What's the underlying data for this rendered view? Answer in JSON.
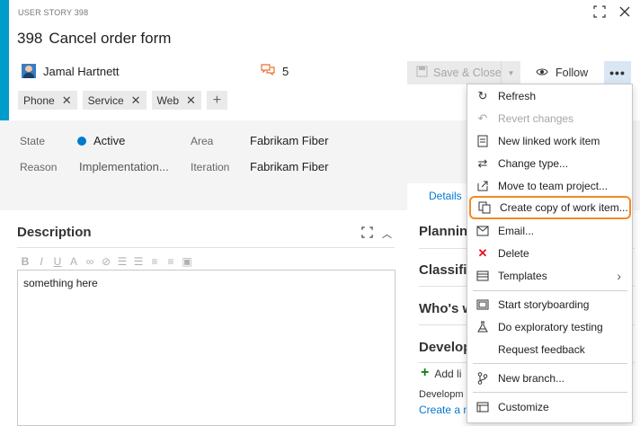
{
  "header": {
    "work_item_type": "USER STORY 398",
    "id": "398",
    "title": "Cancel order form",
    "assignee": "Jamal Hartnett",
    "comment_count": "5",
    "save_label": "Save & Close",
    "follow_label": "Follow",
    "more_label": "•••",
    "accent_color": "#009ccc"
  },
  "tags": [
    "Phone",
    "Service",
    "Web"
  ],
  "fields": {
    "state_label": "State",
    "state_value": "Active",
    "reason_label": "Reason",
    "reason_value": "Implementation...",
    "area_label": "Area",
    "area_value": "Fabrikam Fiber",
    "iteration_label": "Iteration",
    "iteration_value": "Fabrikam Fiber",
    "state_color": "#007acc"
  },
  "tabs": {
    "details": "Details"
  },
  "description": {
    "title": "Description",
    "content": "something here"
  },
  "right_sections": {
    "planning": "Plannin",
    "classification": "Classific",
    "whos": "Who's w",
    "development": "Develop",
    "add_link": "Add li",
    "dev_text": "Developm",
    "create_link": "Create a n"
  },
  "menu": {
    "items": [
      {
        "label": "Refresh",
        "icon": "refresh-icon",
        "disabled": false
      },
      {
        "label": "Revert changes",
        "icon": "revert-icon",
        "disabled": true
      },
      {
        "label": "New linked work item",
        "icon": "new-linked-work-item-icon",
        "disabled": false
      },
      {
        "label": "Change type...",
        "icon": "change-type-icon",
        "disabled": false
      },
      {
        "label": "Move to team project...",
        "icon": "move-icon",
        "disabled": false
      },
      {
        "label": "Create copy of work item...",
        "icon": "copy-icon",
        "disabled": false,
        "highlighted": true
      },
      {
        "label": "Email...",
        "icon": "email-icon",
        "disabled": false
      },
      {
        "label": "Delete",
        "icon": "delete-icon",
        "disabled": false
      },
      {
        "label": "Templates",
        "icon": "templates-icon",
        "disabled": false,
        "submenu": true
      },
      {
        "label": "Start storyboarding",
        "icon": "storyboard-icon",
        "disabled": false
      },
      {
        "label": "Do exploratory testing",
        "icon": "exploratory-testing-icon",
        "disabled": false
      },
      {
        "label": "Request feedback",
        "icon": "",
        "disabled": false
      },
      {
        "label": "New branch...",
        "icon": "branch-icon",
        "disabled": false
      },
      {
        "label": "Customize",
        "icon": "customize-icon",
        "disabled": false
      }
    ],
    "highlight_color": "#f08a24"
  }
}
